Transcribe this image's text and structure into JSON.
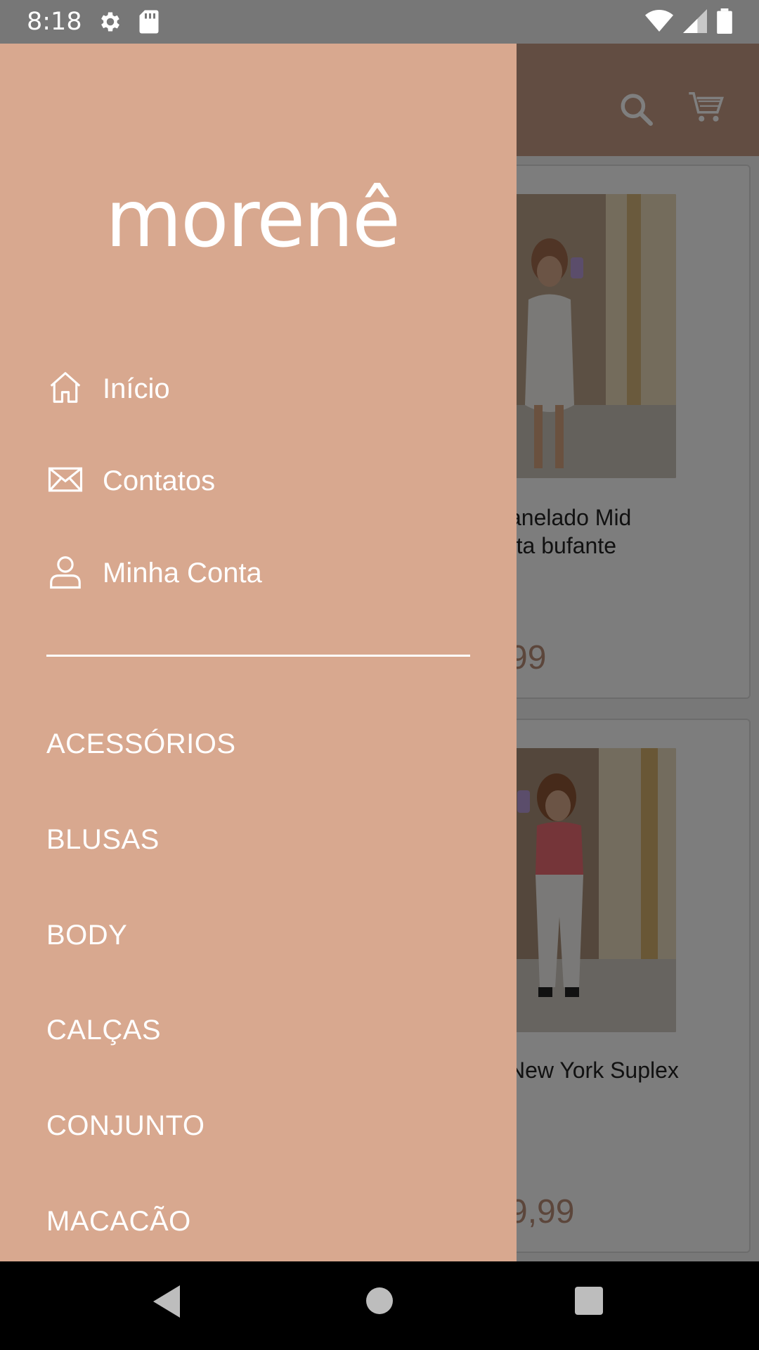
{
  "status_bar": {
    "time": "8:18",
    "icons": [
      "settings-icon",
      "sd-card-icon",
      "wifi-icon",
      "cell-signal-icon",
      "battery-icon"
    ]
  },
  "app_bar": {
    "icons": [
      "search-icon",
      "cart-icon"
    ],
    "color": "#c49a84"
  },
  "products": [
    {
      "title": "anelado Mid\nrta bufante",
      "price": "99"
    },
    {
      "title": "New York Suplex",
      "price": "9,99"
    }
  ],
  "drawer": {
    "brand": "morenê",
    "background": "#d8a88f",
    "menu": [
      {
        "label": "Início",
        "icon": "home-icon"
      },
      {
        "label": "Contatos",
        "icon": "mail-icon"
      },
      {
        "label": "Minha Conta",
        "icon": "user-icon"
      }
    ],
    "categories": [
      "ACESSÓRIOS",
      "BLUSAS",
      "BODY",
      "CALÇAS",
      "CONJUNTO",
      "MACACÃO"
    ]
  },
  "nav_bar": {
    "icons": [
      "back-icon",
      "home-circle-icon",
      "recents-icon"
    ]
  }
}
